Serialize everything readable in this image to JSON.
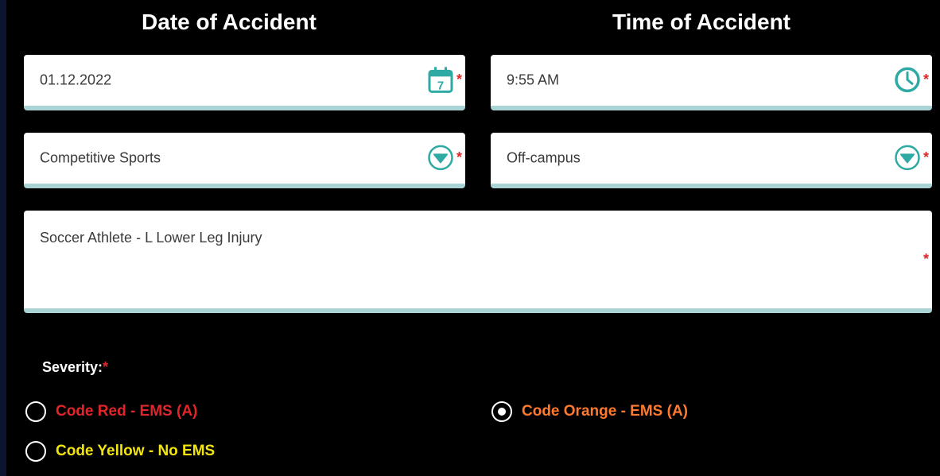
{
  "headers": {
    "date": "Date of Accident",
    "time": "Time of Accident"
  },
  "fields": {
    "date_value": "01.12.2022",
    "time_value": "9:55 AM",
    "activity_value": "Competitive Sports",
    "location_value": "Off-campus",
    "description_value": "Soccer Athlete - L Lower Leg Injury",
    "required_marker": "*"
  },
  "severity": {
    "label": "Severity:",
    "required_marker": "*",
    "options": [
      {
        "label": "Code Red - EMS (A)",
        "color": "#e0262a",
        "selected": false
      },
      {
        "label": "Code Orange - EMS (A)",
        "color": "#ff7a2e",
        "selected": true
      },
      {
        "label": "Code Yellow - No EMS",
        "color": "#f2e40f",
        "selected": false
      }
    ]
  },
  "colors": {
    "accent": "#2fa9a3",
    "field_border": "#a9d3d5",
    "background": "#000000"
  },
  "icons": {
    "date": "calendar-icon",
    "time": "clock-icon",
    "dropdown": "chevron-down-circle-icon"
  }
}
